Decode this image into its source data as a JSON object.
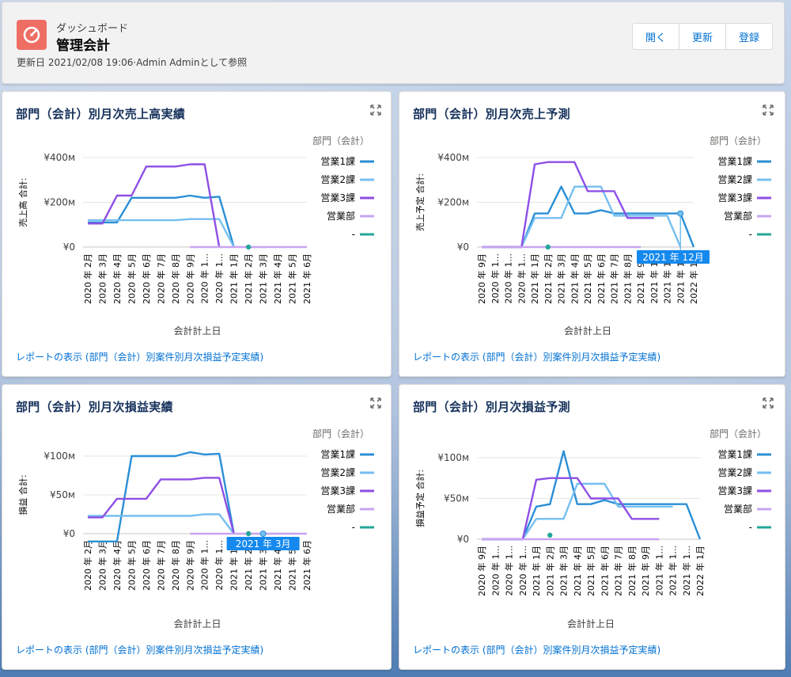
{
  "header": {
    "subtitle": "ダッシュボード",
    "title": "管理会計",
    "info": "更新日 2021/02/08 19:06·Admin Adminとして参照",
    "buttons": [
      "開く",
      "更新",
      "登録"
    ]
  },
  "link_text": "レポートの表示 (部門（会計）別案件別月次損益予定実績)",
  "legend_title": "部門（会計）",
  "colors": {
    "営業1課": "#2a8fd6",
    "営業2課": "#76bff0",
    "営業3課": "#8e4fe6",
    "営業部": "#c8a4f0",
    "-": "#26a69a"
  },
  "chart_data": [
    {
      "type": "line",
      "title": "部門（会計）別月次売上高実績",
      "xlabel": "会計計上日",
      "ylabel": "売上高 合計:",
      "ylim": [
        0,
        400
      ],
      "yticks": [
        "¥0",
        "¥200м",
        "¥400м"
      ],
      "ytick_values": [
        0,
        200,
        400
      ],
      "categories": [
        "2020 年 2月",
        "2020 年 3月",
        "2020 年 4月",
        "2020 年 5月",
        "2020 年 6月",
        "2020 年 7月",
        "2020 年 8月",
        "2020 年 9月",
        "2020 年 1...",
        "2020 年 1...",
        "2021 年 1月",
        "2021 年 2月",
        "2021 年 3月",
        "2021 年 4月",
        "2021 年 5月",
        "2021 年 6月"
      ],
      "series": [
        {
          "name": "営業1課",
          "values": [
            110,
            110,
            110,
            220,
            220,
            220,
            220,
            230,
            220,
            225,
            0,
            null,
            null,
            null,
            null,
            null
          ]
        },
        {
          "name": "営業2課",
          "values": [
            120,
            120,
            120,
            120,
            120,
            120,
            120,
            125,
            125,
            125,
            0,
            null,
            null,
            null,
            null,
            null
          ]
        },
        {
          "name": "営業3課",
          "values": [
            105,
            105,
            230,
            230,
            360,
            360,
            360,
            370,
            370,
            0,
            null,
            null,
            null,
            null,
            null,
            null
          ]
        },
        {
          "name": "営業部",
          "values": [
            null,
            null,
            null,
            null,
            null,
            null,
            null,
            0,
            0,
            0,
            0,
            0,
            0,
            0,
            0,
            0
          ]
        },
        {
          "name": "-",
          "values": [
            null,
            null,
            null,
            null,
            null,
            null,
            null,
            null,
            null,
            null,
            null,
            0,
            null,
            null,
            null,
            null
          ]
        }
      ]
    },
    {
      "type": "line",
      "title": "部門（会計）別月次売上予測",
      "xlabel": "会計計上日",
      "ylabel": "売上予定 合計:",
      "ylim": [
        0,
        400
      ],
      "yticks": [
        "¥0",
        "¥200м",
        "¥400м"
      ],
      "ytick_values": [
        0,
        200,
        400
      ],
      "tooltip": "2021 年 12月",
      "categories": [
        "2020 年 9月",
        "2020 年 1...",
        "2020 年 1...",
        "2020 年 1...",
        "2021 年 1月",
        "2021 年 2月",
        "2021 年 3月",
        "2021 年 4月",
        "2021 年 5月",
        "2021 年 6月",
        "2021 年 7月",
        "2021 年 8月",
        "2021 年 9月",
        "2021 年 1...",
        "2021 年 1...",
        "2021 年 1...",
        "2022 年 1月"
      ],
      "series": [
        {
          "name": "営業1課",
          "values": [
            0,
            0,
            0,
            0,
            150,
            150,
            270,
            150,
            150,
            165,
            150,
            150,
            150,
            150,
            150,
            150,
            0
          ]
        },
        {
          "name": "営業2課",
          "values": [
            0,
            0,
            0,
            0,
            130,
            130,
            130,
            270,
            270,
            270,
            140,
            140,
            140,
            140,
            140,
            0,
            null
          ]
        },
        {
          "name": "営業3課",
          "values": [
            0,
            0,
            0,
            0,
            370,
            380,
            380,
            380,
            250,
            250,
            250,
            130,
            130,
            130,
            null,
            null,
            null
          ]
        },
        {
          "name": "営業部",
          "values": [
            0,
            0,
            0,
            0,
            0,
            0,
            0,
            0,
            0,
            0,
            0,
            0,
            0,
            null,
            null,
            null,
            null
          ]
        },
        {
          "name": "-",
          "values": [
            null,
            null,
            null,
            null,
            null,
            0,
            null,
            null,
            null,
            null,
            null,
            null,
            null,
            null,
            null,
            null,
            null
          ]
        }
      ]
    },
    {
      "type": "line",
      "title": "部門（会計）別月次損益実績",
      "xlabel": "会計計上日",
      "ylabel": "損益 合計:",
      "ylim": [
        0,
        100
      ],
      "yticks": [
        "¥0",
        "¥50м",
        "¥100м"
      ],
      "ytick_values": [
        0,
        50,
        100
      ],
      "tooltip": "2021 年 3月",
      "categories": [
        "2020 年 2月",
        "2020 年 3月",
        "2020 年 4月",
        "2020 年 5月",
        "2020 年 6月",
        "2020 年 7月",
        "2020 年 8月",
        "2020 年 9月",
        "2020 年 1...",
        "2020 年 1...",
        "2021 年 1月",
        "2021 年 2月",
        "2021 年 3月",
        "2021 年 4月",
        "2021 年 5月",
        "2021 年 6月"
      ],
      "series": [
        {
          "name": "営業1課",
          "values": [
            -10,
            -10,
            -10,
            100,
            100,
            100,
            100,
            105,
            102,
            103,
            0,
            null,
            null,
            null,
            null,
            null
          ]
        },
        {
          "name": "営業2課",
          "values": [
            23,
            23,
            23,
            23,
            23,
            23,
            23,
            23,
            25,
            25,
            0,
            null,
            null,
            null,
            null,
            null
          ]
        },
        {
          "name": "営業3課",
          "values": [
            21,
            21,
            45,
            45,
            45,
            70,
            70,
            70,
            72,
            72,
            0,
            null,
            null,
            null,
            null,
            null
          ]
        },
        {
          "name": "営業部",
          "values": [
            null,
            null,
            null,
            null,
            null,
            null,
            null,
            0,
            0,
            0,
            0,
            0,
            0,
            0,
            0,
            0
          ]
        },
        {
          "name": "-",
          "values": [
            null,
            null,
            null,
            null,
            null,
            null,
            null,
            null,
            null,
            null,
            null,
            0,
            null,
            null,
            null,
            null
          ]
        }
      ]
    },
    {
      "type": "line",
      "title": "部門（会計）別月次損益予測",
      "xlabel": "会計計上日",
      "ylabel": "損益予定 合計:",
      "ylim": [
        0,
        100
      ],
      "yticks": [
        "¥0",
        "¥50м",
        "¥100м"
      ],
      "ytick_values": [
        0,
        50,
        100
      ],
      "categories": [
        "2020 年 9月",
        "2020 年 1...",
        "2020 年 1...",
        "2020 年 1...",
        "2021 年 1月",
        "2021 年 2月",
        "2021 年 3月",
        "2021 年 4月",
        "2021 年 5月",
        "2021 年 6月",
        "2021 年 7月",
        "2021 年 8月",
        "2021 年 9月",
        "2021 年 1...",
        "2021 年 1...",
        "2021 年 1...",
        "2022 年 1月"
      ],
      "series": [
        {
          "name": "営業1課",
          "values": [
            0,
            0,
            0,
            0,
            40,
            43,
            108,
            43,
            43,
            48,
            43,
            43,
            43,
            43,
            43,
            43,
            0
          ]
        },
        {
          "name": "営業2課",
          "values": [
            0,
            0,
            0,
            0,
            25,
            25,
            25,
            68,
            68,
            68,
            40,
            40,
            40,
            40,
            40,
            null,
            null
          ]
        },
        {
          "name": "営業3課",
          "values": [
            0,
            0,
            0,
            0,
            73,
            75,
            75,
            75,
            50,
            50,
            50,
            25,
            25,
            25,
            null,
            null,
            null
          ]
        },
        {
          "name": "営業部",
          "values": [
            0,
            0,
            0,
            0,
            0,
            0,
            0,
            0,
            0,
            0,
            0,
            0,
            0,
            0,
            null,
            null,
            null
          ]
        },
        {
          "name": "-",
          "values": [
            null,
            null,
            null,
            null,
            null,
            5,
            null,
            null,
            null,
            null,
            null,
            null,
            null,
            null,
            null,
            null,
            null
          ]
        }
      ]
    }
  ]
}
